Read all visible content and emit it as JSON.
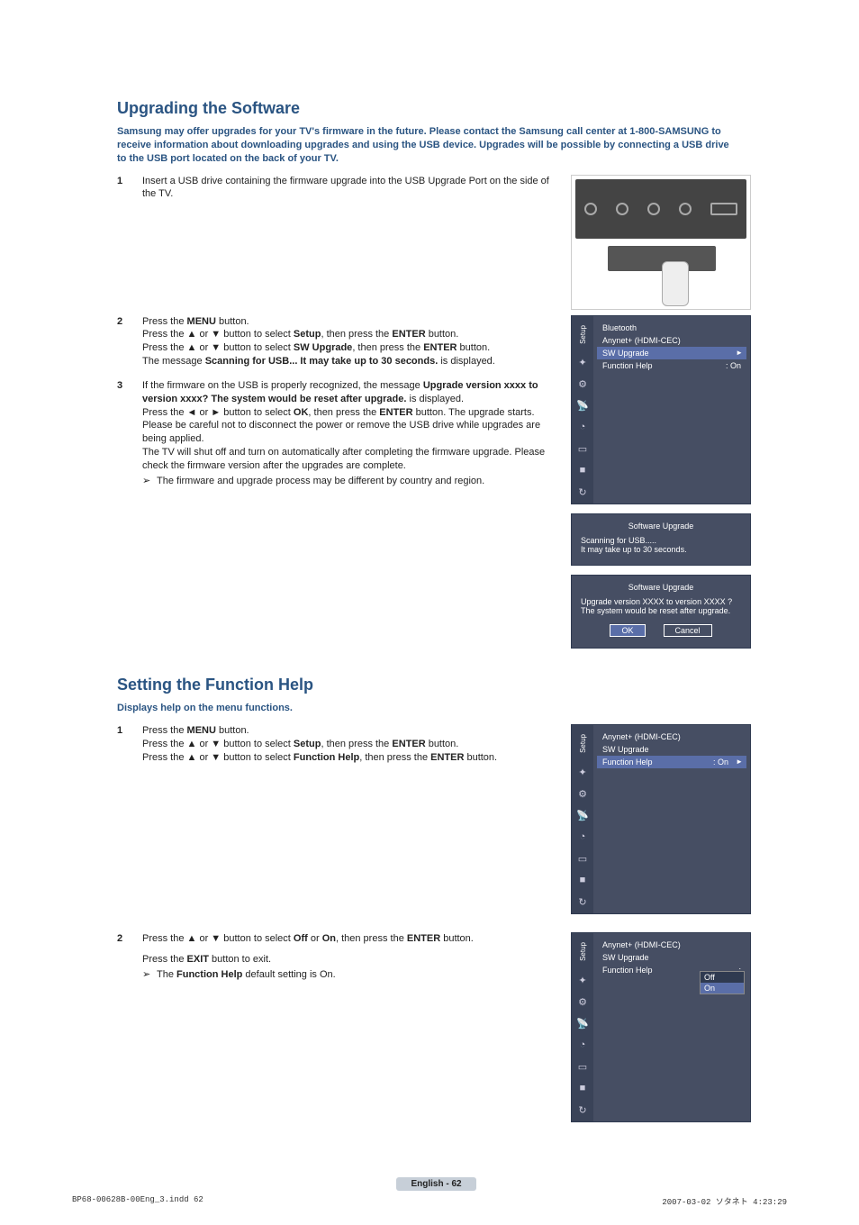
{
  "section1": {
    "heading": "Upgrading the Software",
    "intro": "Samsung may offer upgrades for your TV's firmware in the future. Please contact the Samsung call center at 1-800-SAMSUNG to receive information about downloading upgrades and using the USB device. Upgrades will be possible by connecting a USB drive to the USB port located on the back of your TV.",
    "step1": {
      "num": "1",
      "text": "Insert a USB drive containing the firmware upgrade into the USB Upgrade Port on the side of the TV."
    },
    "step2": {
      "num": "2",
      "l1a": "Press the ",
      "l1b": "MENU",
      "l1c": " button.",
      "l2a": "Press the ▲ or ▼ button to select ",
      "l2b": "Setup",
      "l2c": ", then press the ",
      "l2d": "ENTER",
      "l2e": " button.",
      "l3a": "Press the ▲ or ▼ button to select ",
      "l3b": "SW Upgrade",
      "l3c": ", then press the ",
      "l3d": "ENTER",
      "l3e": " button.",
      "l4a": "The message ",
      "l4b": "Scanning for USB... It may take up to 30 seconds.",
      "l4c": " is displayed."
    },
    "step3": {
      "num": "3",
      "l1a": "If the firmware on the USB is properly recognized, the message ",
      "l1b": "Upgrade version xxxx to version xxxx? The system would be reset after upgrade.",
      "l1c": " is displayed.",
      "l2a": "Press the ◄ or ► button to select ",
      "l2b": "OK",
      "l2c": ", then press the ",
      "l2d": "ENTER",
      "l2e": " button. The upgrade starts.",
      "l3": "Please be careful not to disconnect the power or remove the USB drive while upgrades are being applied.",
      "l4": "The TV will shut off and turn on automatically after completing the firmware upgrade. Please check the firmware version after the upgrades are complete.",
      "note": "The firmware and upgrade process may be different by country and region."
    }
  },
  "menu1": {
    "sidebarLabel": "Setup",
    "items": [
      "Bluetooth",
      "Anynet+ (HDMI-CEC)",
      "SW Upgrade",
      "Function Help"
    ],
    "fh_val": ": On"
  },
  "popup1": {
    "title": "Software Upgrade",
    "l1": "Scanning for USB.....",
    "l2": "It may take up to 30 seconds."
  },
  "popup2": {
    "title": "Software Upgrade",
    "msg": "Upgrade version XXXX to version XXXX ? The system would be reset after upgrade.",
    "ok": "OK",
    "cancel": "Cancel"
  },
  "section2": {
    "heading": "Setting the Function Help",
    "intro": "Displays help on the menu functions.",
    "step1": {
      "num": "1",
      "l1a": "Press the ",
      "l1b": "MENU",
      "l1c": " button.",
      "l2a": "Press the ▲ or ▼ button to select ",
      "l2b": "Setup",
      "l2c": ", then press the ",
      "l2d": "ENTER",
      "l2e": " button.",
      "l3a": "Press the ▲ or ▼ button to select ",
      "l3b": "Function Help",
      "l3c": ", then press the ",
      "l3d": "ENTER",
      "l3e": " button."
    },
    "step2": {
      "num": "2",
      "l1a": "Press the ▲ or ▼ button to select ",
      "l1b": "Off",
      "l1c": " or ",
      "l1d": "On",
      "l1e": ", then press the ",
      "l1f": "ENTER",
      "l1g": " button.",
      "l2a": "Press the ",
      "l2b": "EXIT",
      "l2c": " button to exit.",
      "notea": "The ",
      "noteb": "Function Help",
      "notec": " default setting is On."
    }
  },
  "menu2": {
    "sidebarLabel": "Setup",
    "items": [
      "Anynet+ (HDMI-CEC)",
      "SW Upgrade",
      "Function Help"
    ],
    "fh_val": ": On"
  },
  "menu3": {
    "sidebarLabel": "Setup",
    "items": [
      "Anynet+ (HDMI-CEC)",
      "SW Upgrade",
      "Function Help"
    ],
    "fh_prefix": ":",
    "opt_off": "Off",
    "opt_on": "On"
  },
  "page": {
    "label": "English - 62"
  },
  "footer": {
    "left": "BP68-00628B-00Eng_3.indd   62",
    "right": "2007-03-02   ソタネト 4:23:29"
  }
}
